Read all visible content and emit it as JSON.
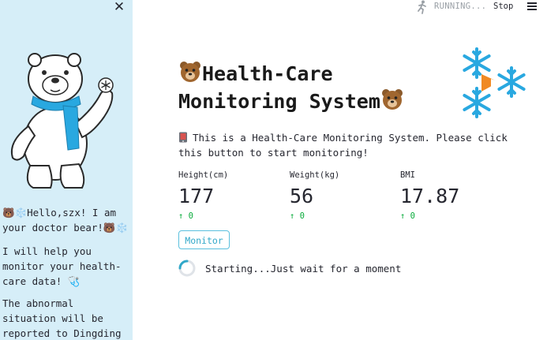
{
  "sidebar": {
    "close_icon": "close-icon",
    "greeting": "🐻❄️Hello,szx! I am your doctor bear!🐻❄️",
    "help_text": "I will help you monitor your health-care data! 🩺",
    "abnormal_text": "The abnormal situation will be reported to Dingding robot! ⭐",
    "mascot_badge": "snowflake"
  },
  "topbar": {
    "status_text": "RUNNING...",
    "stop_label": "Stop",
    "menu_icon": "hamburger-menu-icon"
  },
  "main": {
    "title_line1": "Health-Care",
    "title_line2": "Monitoring System",
    "intro_text": "This is a Health-Care Monitoring System. Please click this button to start monitoring!",
    "metrics": [
      {
        "label": "Height(cm)",
        "value": "177",
        "delta": "↑ 0"
      },
      {
        "label": "Weight(kg)",
        "value": "56",
        "delta": "↑ 0"
      },
      {
        "label": "BMI",
        "value": "17.87",
        "delta": "↑ 0"
      }
    ],
    "monitor_label": "Monitor",
    "status_text": "Starting...Just wait for a moment"
  },
  "colors": {
    "sidebar_bg": "#d6eef8",
    "accent": "#31a8c9",
    "delta_green": "#09ab3b",
    "snowflake_blue": "#29a8e0",
    "arrow_orange": "#f08a24"
  }
}
